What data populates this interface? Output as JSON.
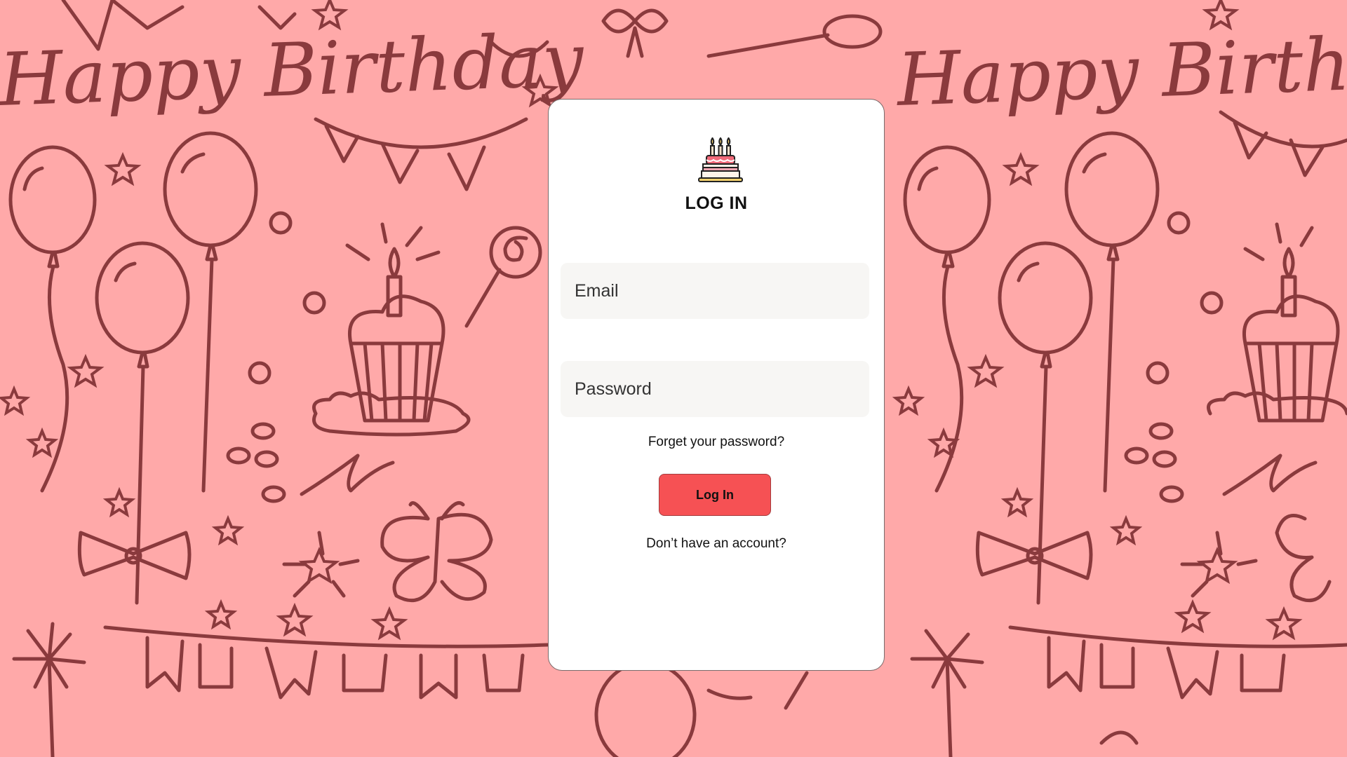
{
  "background": {
    "pattern_text": "Happy Birthday",
    "bg_color": "#ffa9a9",
    "ink_color": "#8a3a3d"
  },
  "login": {
    "logo_icon": "birthday-cake-icon",
    "title": "LOG IN",
    "email_placeholder": "Email",
    "password_placeholder": "Password",
    "forgot_link": "Forget your password?",
    "submit_label": "Log In",
    "signup_link": "Don’t have an account?",
    "accent_color": "#f65154"
  }
}
